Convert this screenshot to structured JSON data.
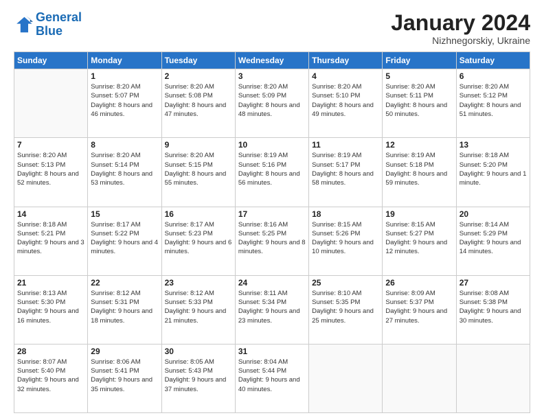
{
  "logo": {
    "line1": "General",
    "line2": "Blue"
  },
  "title": "January 2024",
  "subtitle": "Nizhnegorskiy, Ukraine",
  "header_days": [
    "Sunday",
    "Monday",
    "Tuesday",
    "Wednesday",
    "Thursday",
    "Friday",
    "Saturday"
  ],
  "weeks": [
    [
      {
        "day": "",
        "sunrise": "",
        "sunset": "",
        "daylight": ""
      },
      {
        "day": "1",
        "sunrise": "Sunrise: 8:20 AM",
        "sunset": "Sunset: 5:07 PM",
        "daylight": "Daylight: 8 hours and 46 minutes."
      },
      {
        "day": "2",
        "sunrise": "Sunrise: 8:20 AM",
        "sunset": "Sunset: 5:08 PM",
        "daylight": "Daylight: 8 hours and 47 minutes."
      },
      {
        "day": "3",
        "sunrise": "Sunrise: 8:20 AM",
        "sunset": "Sunset: 5:09 PM",
        "daylight": "Daylight: 8 hours and 48 minutes."
      },
      {
        "day": "4",
        "sunrise": "Sunrise: 8:20 AM",
        "sunset": "Sunset: 5:10 PM",
        "daylight": "Daylight: 8 hours and 49 minutes."
      },
      {
        "day": "5",
        "sunrise": "Sunrise: 8:20 AM",
        "sunset": "Sunset: 5:11 PM",
        "daylight": "Daylight: 8 hours and 50 minutes."
      },
      {
        "day": "6",
        "sunrise": "Sunrise: 8:20 AM",
        "sunset": "Sunset: 5:12 PM",
        "daylight": "Daylight: 8 hours and 51 minutes."
      }
    ],
    [
      {
        "day": "7",
        "sunrise": "Sunrise: 8:20 AM",
        "sunset": "Sunset: 5:13 PM",
        "daylight": "Daylight: 8 hours and 52 minutes."
      },
      {
        "day": "8",
        "sunrise": "Sunrise: 8:20 AM",
        "sunset": "Sunset: 5:14 PM",
        "daylight": "Daylight: 8 hours and 53 minutes."
      },
      {
        "day": "9",
        "sunrise": "Sunrise: 8:20 AM",
        "sunset": "Sunset: 5:15 PM",
        "daylight": "Daylight: 8 hours and 55 minutes."
      },
      {
        "day": "10",
        "sunrise": "Sunrise: 8:19 AM",
        "sunset": "Sunset: 5:16 PM",
        "daylight": "Daylight: 8 hours and 56 minutes."
      },
      {
        "day": "11",
        "sunrise": "Sunrise: 8:19 AM",
        "sunset": "Sunset: 5:17 PM",
        "daylight": "Daylight: 8 hours and 58 minutes."
      },
      {
        "day": "12",
        "sunrise": "Sunrise: 8:19 AM",
        "sunset": "Sunset: 5:18 PM",
        "daylight": "Daylight: 8 hours and 59 minutes."
      },
      {
        "day": "13",
        "sunrise": "Sunrise: 8:18 AM",
        "sunset": "Sunset: 5:20 PM",
        "daylight": "Daylight: 9 hours and 1 minute."
      }
    ],
    [
      {
        "day": "14",
        "sunrise": "Sunrise: 8:18 AM",
        "sunset": "Sunset: 5:21 PM",
        "daylight": "Daylight: 9 hours and 3 minutes."
      },
      {
        "day": "15",
        "sunrise": "Sunrise: 8:17 AM",
        "sunset": "Sunset: 5:22 PM",
        "daylight": "Daylight: 9 hours and 4 minutes."
      },
      {
        "day": "16",
        "sunrise": "Sunrise: 8:17 AM",
        "sunset": "Sunset: 5:23 PM",
        "daylight": "Daylight: 9 hours and 6 minutes."
      },
      {
        "day": "17",
        "sunrise": "Sunrise: 8:16 AM",
        "sunset": "Sunset: 5:25 PM",
        "daylight": "Daylight: 9 hours and 8 minutes."
      },
      {
        "day": "18",
        "sunrise": "Sunrise: 8:15 AM",
        "sunset": "Sunset: 5:26 PM",
        "daylight": "Daylight: 9 hours and 10 minutes."
      },
      {
        "day": "19",
        "sunrise": "Sunrise: 8:15 AM",
        "sunset": "Sunset: 5:27 PM",
        "daylight": "Daylight: 9 hours and 12 minutes."
      },
      {
        "day": "20",
        "sunrise": "Sunrise: 8:14 AM",
        "sunset": "Sunset: 5:29 PM",
        "daylight": "Daylight: 9 hours and 14 minutes."
      }
    ],
    [
      {
        "day": "21",
        "sunrise": "Sunrise: 8:13 AM",
        "sunset": "Sunset: 5:30 PM",
        "daylight": "Daylight: 9 hours and 16 minutes."
      },
      {
        "day": "22",
        "sunrise": "Sunrise: 8:12 AM",
        "sunset": "Sunset: 5:31 PM",
        "daylight": "Daylight: 9 hours and 18 minutes."
      },
      {
        "day": "23",
        "sunrise": "Sunrise: 8:12 AM",
        "sunset": "Sunset: 5:33 PM",
        "daylight": "Daylight: 9 hours and 21 minutes."
      },
      {
        "day": "24",
        "sunrise": "Sunrise: 8:11 AM",
        "sunset": "Sunset: 5:34 PM",
        "daylight": "Daylight: 9 hours and 23 minutes."
      },
      {
        "day": "25",
        "sunrise": "Sunrise: 8:10 AM",
        "sunset": "Sunset: 5:35 PM",
        "daylight": "Daylight: 9 hours and 25 minutes."
      },
      {
        "day": "26",
        "sunrise": "Sunrise: 8:09 AM",
        "sunset": "Sunset: 5:37 PM",
        "daylight": "Daylight: 9 hours and 27 minutes."
      },
      {
        "day": "27",
        "sunrise": "Sunrise: 8:08 AM",
        "sunset": "Sunset: 5:38 PM",
        "daylight": "Daylight: 9 hours and 30 minutes."
      }
    ],
    [
      {
        "day": "28",
        "sunrise": "Sunrise: 8:07 AM",
        "sunset": "Sunset: 5:40 PM",
        "daylight": "Daylight: 9 hours and 32 minutes."
      },
      {
        "day": "29",
        "sunrise": "Sunrise: 8:06 AM",
        "sunset": "Sunset: 5:41 PM",
        "daylight": "Daylight: 9 hours and 35 minutes."
      },
      {
        "day": "30",
        "sunrise": "Sunrise: 8:05 AM",
        "sunset": "Sunset: 5:43 PM",
        "daylight": "Daylight: 9 hours and 37 minutes."
      },
      {
        "day": "31",
        "sunrise": "Sunrise: 8:04 AM",
        "sunset": "Sunset: 5:44 PM",
        "daylight": "Daylight: 9 hours and 40 minutes."
      },
      {
        "day": "",
        "sunrise": "",
        "sunset": "",
        "daylight": ""
      },
      {
        "day": "",
        "sunrise": "",
        "sunset": "",
        "daylight": ""
      },
      {
        "day": "",
        "sunrise": "",
        "sunset": "",
        "daylight": ""
      }
    ]
  ]
}
